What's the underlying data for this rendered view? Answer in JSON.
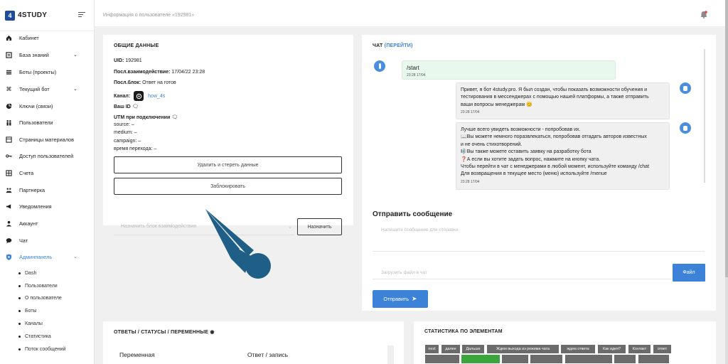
{
  "brand": {
    "logo_letter": "4",
    "name": "4STUDY"
  },
  "breadcrumb": "Информация о пользователе «192981»",
  "sidebar": {
    "items": [
      {
        "label": "Кабинет",
        "icon": "home-icon"
      },
      {
        "label": "База знаний",
        "icon": "book-icon",
        "expandable": true
      },
      {
        "label": "Боты (проекты)",
        "icon": "list-icon"
      },
      {
        "label": "Текущий бот",
        "icon": "command-icon",
        "expandable": true
      },
      {
        "label": "Ключи (связи)",
        "icon": "pie-icon"
      },
      {
        "label": "Пользователи",
        "icon": "users-icon"
      },
      {
        "label": "Страницы материалов",
        "icon": "pages-icon"
      },
      {
        "label": "Доступ пользователей",
        "icon": "key-icon"
      },
      {
        "label": "Счета",
        "icon": "grid-icon"
      },
      {
        "label": "Партнерка",
        "icon": "partners-icon"
      },
      {
        "label": "Уведомления",
        "icon": "megaphone-icon"
      },
      {
        "label": "Аккаунт",
        "icon": "account-icon"
      },
      {
        "label": "Чат",
        "icon": "chat-icon"
      },
      {
        "label": "Админпанель",
        "icon": "shield-icon",
        "expandable": true,
        "active": true
      }
    ],
    "sub_items": [
      "Dash",
      "Пользователи",
      "О пользователе",
      "Боты",
      "Каналы",
      "Статистика",
      "Поток сообщений"
    ]
  },
  "general": {
    "title": "ОБЩИЕ ДАННЫЕ",
    "uid_label": "UID:",
    "uid_value": "192981",
    "last_action_label": "Посл.взаимодействие:",
    "last_action_value": "17/04/22 23:28",
    "last_block_label": "Посл.блок:",
    "last_block_value": "Ответ на готов",
    "channel_label": "Канал:",
    "channel_value": "how_4s",
    "your_id_label": "Ваш ID",
    "utm_title": "UTM при подключении",
    "utm_source": "source: –",
    "utm_medium": "medium: –",
    "utm_campaign": "campaign: –",
    "utm_time": "время перехода: –",
    "delete_button": "Удалить и стереть данные",
    "block_button": "Заблокировать",
    "assign_placeholder": "Назначить блок взаимодействия",
    "assign_button": "Назначить"
  },
  "chat": {
    "title": "ЧАТ",
    "link": "(ПЕРЕЙТИ)",
    "messages": [
      {
        "from": "user",
        "lines": [
          "/start"
        ],
        "time": "23:28 17/04"
      },
      {
        "from": "bot",
        "lines": [
          "Привет, я бот 4study.pro. Я был создан, чтобы показать возможности обучения и",
          "тестирования в мессенджерах с помощью нашей платформы, а также отправить",
          "ваши вопросы менеджерам 😊"
        ],
        "time": "23:28 17/04"
      },
      {
        "from": "bot",
        "lines": [
          "Лучше всего увидеть возможности - попробовав их.",
          "📖Вы можете немного поразвлекаться, попробовав отгадать авторов известных",
          "и не очень стихотворений.",
          "🎼Вы также можете оставить заявку на разработку бота",
          "❓А если вы хотите задать вопрос, нажмите на кнопку чата.",
          "Чтобы перейти в чат с менеджерами в любой момент, используйте команду /chat",
          "Для возвращения в текущее место (меню) используйте /menue"
        ],
        "time": "23:28 17/04"
      }
    ],
    "send_title": "Отправить сообщение",
    "message_placeholder": "Напишите сообщение для отправки",
    "file_placeholder": "Загрузить файл в чат",
    "file_button": "Файл",
    "send_button": "Отправить"
  },
  "answers": {
    "title": "ОТВЕТЫ / СТАТУСЫ / ПЕРЕМЕННЫЕ",
    "col_variable": "Переменная",
    "col_answer": "Ответ / запись"
  },
  "stats": {
    "title": "СТАТИСТИКА ПО ЭЛЕМЕНТАМ",
    "tags": [
      "next",
      "далее",
      "Дальше",
      "Ждем выхода из режима чата",
      "ждем ответа",
      "Как идея?",
      "Контакт",
      "ответ"
    ]
  },
  "colors": {
    "accent": "#3b82d8",
    "brand": "#1e4b9c",
    "annotation_arrow": "#1f5f87"
  }
}
